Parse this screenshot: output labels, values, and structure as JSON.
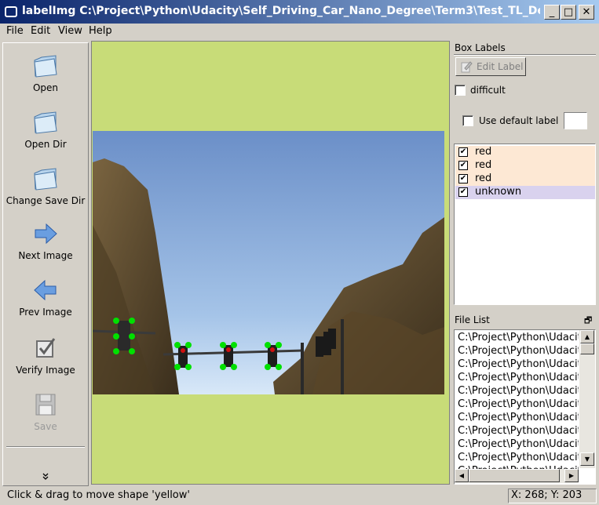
{
  "window": {
    "title": "labelImg C:\\Project\\Python\\Udacity\\Self_Driving_Car_Nano_Degree\\Term3\\Test_TL_Detec...",
    "minimize": "_",
    "maximize": "□",
    "close": "✕"
  },
  "menu": [
    "File",
    "Edit",
    "View",
    "Help"
  ],
  "toolbar": {
    "open": "Open",
    "open_dir": "Open Dir",
    "change_save_dir": "Change Save Dir",
    "next_image": "Next Image",
    "prev_image": "Prev Image",
    "verify_image": "Verify Image",
    "save": "Save",
    "more": "»"
  },
  "box_labels": {
    "title": "Box Labels",
    "edit_label": "Edit Label",
    "difficult": "difficult",
    "use_default_label": "Use default label",
    "default_label_value": "",
    "items": [
      {
        "label": "red",
        "checked": "✔",
        "color": "#fde8d4"
      },
      {
        "label": "red",
        "checked": "✔",
        "color": "#fde8d4"
      },
      {
        "label": "red",
        "checked": "✔",
        "color": "#fde8d4"
      },
      {
        "label": "unknown",
        "checked": "✔",
        "color": "#d9d2ee"
      }
    ]
  },
  "file_list": {
    "title": "File List",
    "float_icon": "🗗",
    "items": [
      "C:\\Project\\Python\\Udacity",
      "C:\\Project\\Python\\Udacity",
      "C:\\Project\\Python\\Udacity",
      "C:\\Project\\Python\\Udacity",
      "C:\\Project\\Python\\Udacity",
      "C:\\Project\\Python\\Udacity",
      "C:\\Project\\Python\\Udacity",
      "C:\\Project\\Python\\Udacity",
      "C:\\Project\\Python\\Udacity",
      "C:\\Project\\Python\\Udacity",
      "C:\\Project\\Python\\Udacity"
    ]
  },
  "status": {
    "message": "Click & drag to move shape 'yellow'",
    "coords": "X: 268; Y: 203"
  },
  "colors": {
    "canvas_bg": "#c8dc78",
    "point": "#00e000",
    "label_selected": "#d9d2ee",
    "label_row": "#fde8d4"
  }
}
